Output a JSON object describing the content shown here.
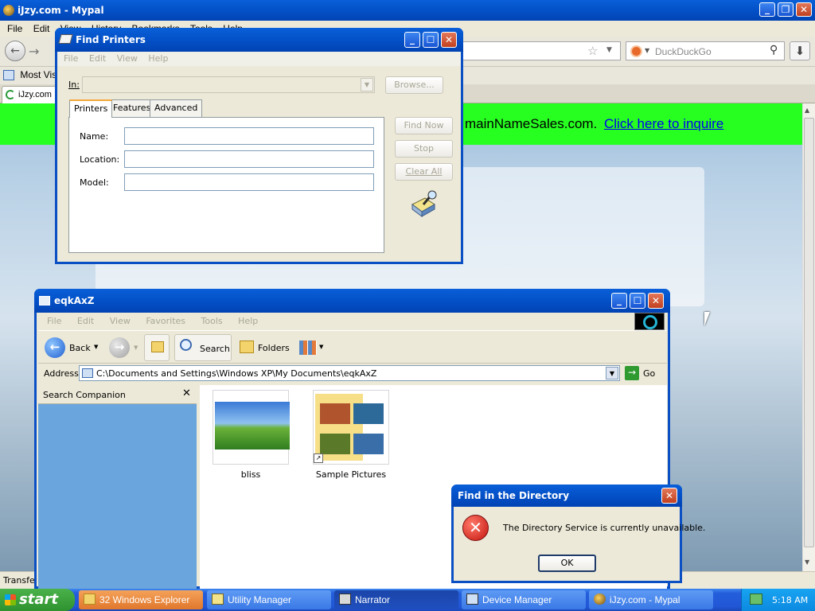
{
  "browser": {
    "title": "iJzy.com - Mypal",
    "menu": [
      "File",
      "Edit",
      "View",
      "History",
      "Bookmarks",
      "Tools",
      "Help"
    ],
    "search_placeholder": "DuckDuckGo",
    "bookmarks_item": "Most Visited",
    "tab_label": "iJzy.com",
    "banner_text": "mainNameSales.com.",
    "banner_link": "Click here to inquire",
    "status_text": "Transferring data from ..."
  },
  "find_printers": {
    "title": "Find Printers",
    "menu": [
      "File",
      "Edit",
      "View",
      "Help"
    ],
    "in_label": "In:",
    "browse_label": "Browse...",
    "tabs": [
      "Printers",
      "Features",
      "Advanced"
    ],
    "fields": [
      {
        "label": "Name:",
        "value": ""
      },
      {
        "label": "Location:",
        "value": ""
      },
      {
        "label": "Model:",
        "value": ""
      }
    ],
    "find_now_label": "Find Now",
    "stop_label": "Stop",
    "clear_all_label": "Clear All"
  },
  "explorer": {
    "title": "eqkAxZ",
    "menu": [
      "File",
      "Edit",
      "View",
      "Favorites",
      "Tools",
      "Help"
    ],
    "back_label": "Back",
    "search_label": "Search",
    "folders_label": "Folders",
    "address_label": "Address",
    "address_value": "C:\\Documents and Settings\\Windows XP\\My Documents\\eqkAxZ",
    "go_label": "Go",
    "companion_title": "Search Companion",
    "items": [
      {
        "name": "bliss"
      },
      {
        "name": "Sample Pictures"
      }
    ]
  },
  "dialog": {
    "title": "Find in the Directory",
    "message": "The Directory Service is currently unavailable.",
    "ok_label": "OK"
  },
  "taskbar": {
    "start_label": "start",
    "tasks": [
      {
        "label": "32 Windows Explorer"
      },
      {
        "label": "Utility Manager"
      },
      {
        "label": "Narrator"
      },
      {
        "label": "Device Manager"
      },
      {
        "label": "iJzy.com - Mypal"
      }
    ],
    "clock": "5:18 AM"
  },
  "colors": {
    "xp_title_blue": "#0452c9",
    "banner_green": "#27ff21",
    "link_blue": "#0000ee",
    "error_red": "#d8261c"
  }
}
